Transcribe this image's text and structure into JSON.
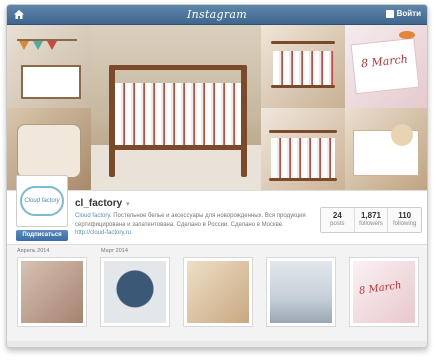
{
  "header": {
    "title": "Instagram",
    "login_label": "Войти"
  },
  "cover": {
    "note_1": "8 March",
    "note_2": "8 March"
  },
  "profile": {
    "username": "cl_factory",
    "menu_symbol": "▾",
    "avatar_text": "Cloud factory",
    "follow_label": "Подписаться",
    "bio_brand": "Cloud factory",
    "bio_text": ". Постельное белье и аксессуары для новорожденных. Вся продукция сертифицирована и запатентована. Сделано в России. Сделано в Москве.",
    "bio_link": "http://cloud-factory.ru",
    "stats": [
      {
        "value": "24",
        "label": "posts"
      },
      {
        "value": "1,871",
        "label": "followers"
      },
      {
        "value": "110",
        "label": "following"
      }
    ]
  },
  "feed": {
    "months": [
      "Апрель 2014",
      "Март 2014"
    ],
    "thumb_colors": [
      "#b89b86",
      "#dfe3e6",
      "#e0c9a8",
      "#cfd6df",
      "#f3e3e6"
    ]
  }
}
